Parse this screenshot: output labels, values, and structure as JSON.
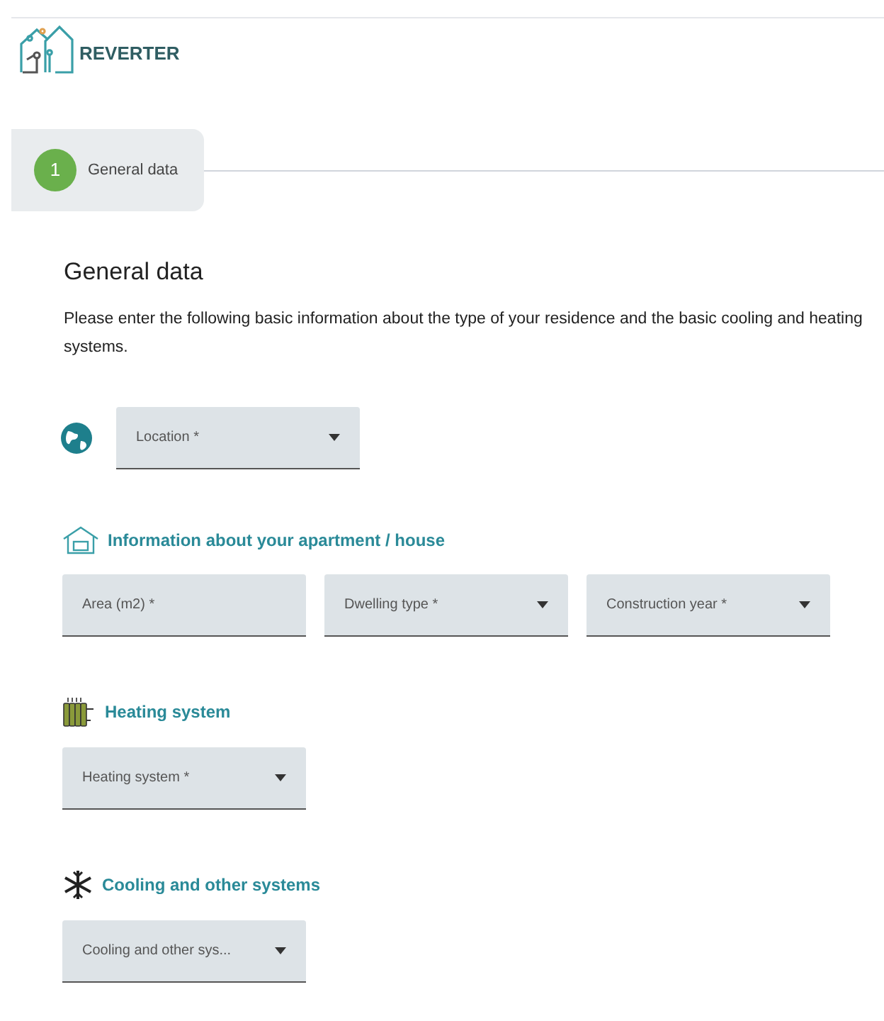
{
  "brand": {
    "name": "REVERTER"
  },
  "steps": [
    {
      "number": "1",
      "label": "General data",
      "selected": true
    }
  ],
  "title": "General data",
  "intro": "Please enter the following basic information about the type of your residence and the basic cooling and heating systems.",
  "location": {
    "label": "Location *",
    "kind": "select"
  },
  "sections": [
    {
      "title": "Information about your apartment / house",
      "fields": [
        {
          "label": "Area (m2) *",
          "kind": "text"
        },
        {
          "label": "Dwelling type *",
          "kind": "select"
        },
        {
          "label": "Construction year *",
          "kind": "select"
        }
      ]
    },
    {
      "title": "Heating system",
      "fields": [
        {
          "label": "Heating system *",
          "kind": "select"
        }
      ]
    },
    {
      "title": "Cooling and other systems",
      "fields": [
        {
          "label": "Cooling and other sys...",
          "kind": "select"
        }
      ]
    }
  ]
}
